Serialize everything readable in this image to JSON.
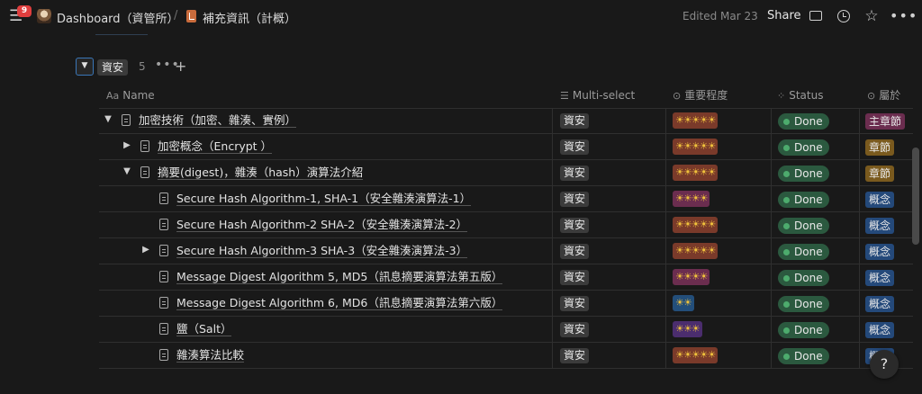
{
  "topbar": {
    "notification_count": "9",
    "workspace_title": "Dashboard（資管所）",
    "separator": "/",
    "page_title": "補充資訊（計概）",
    "edited": "Edited Mar 23",
    "share_label": "Share",
    "icons": [
      "menu-icon",
      "comment-icon",
      "clock-icon",
      "star-icon",
      "more-icon"
    ]
  },
  "group": {
    "toggle_glyph": "▼",
    "tag": "資安",
    "count": "5",
    "more": "•••",
    "add": "+"
  },
  "columns": {
    "name": "Name",
    "name_prefix": "Aa",
    "multiselect": "Multi-select",
    "multiselect_prefix": "☰",
    "importance": "重要程度",
    "importance_prefix": "⊙",
    "status": "Status",
    "status_prefix": "⁘",
    "belong": "屬於",
    "belong_prefix": "⊙"
  },
  "colors": {
    "stars5": "#7a3a2a",
    "stars4": "#6b2d4f",
    "stars3": "#4b2d6e",
    "stars2": "#234e7a",
    "belong_main": "#6b2d4f",
    "belong_chapter": "#7a5a1e",
    "belong_concept": "#24497a",
    "status_bg": "#2b593f"
  },
  "rows": [
    {
      "indent": 0,
      "chevron": "▼",
      "title": "加密技術（加密、雜湊、實例）",
      "multi": "資安",
      "importance": "☀☀☀☀☀",
      "level": 5,
      "status": "Done",
      "belong": "主章節",
      "belong_type": "main"
    },
    {
      "indent": 1,
      "chevron": "▶",
      "title": "加密概念（Encrypt ）",
      "multi": "資安",
      "importance": "☀☀☀☀☀",
      "level": 5,
      "status": "Done",
      "belong": "章節",
      "belong_type": "chapter"
    },
    {
      "indent": 1,
      "chevron": "▼",
      "title": "摘要(digest)，雜湊（hash）演算法介紹",
      "multi": "資安",
      "importance": "☀☀☀☀☀",
      "level": 5,
      "status": "Done",
      "belong": "章節",
      "belong_type": "chapter"
    },
    {
      "indent": 2,
      "chevron": "",
      "title": "Secure Hash Algorithm-1, SHA-1（安全雜湊演算法-1）",
      "multi": "資安",
      "importance": "☀☀☀☀",
      "level": 4,
      "status": "Done",
      "belong": "概念",
      "belong_type": "concept"
    },
    {
      "indent": 2,
      "chevron": "",
      "title": "Secure Hash Algorithm-2 SHA-2（安全雜湊演算法-2）",
      "multi": "資安",
      "importance": "☀☀☀☀☀",
      "level": 5,
      "status": "Done",
      "belong": "概念",
      "belong_type": "concept"
    },
    {
      "indent": 2,
      "chevron": "▶",
      "title": "Secure Hash Algorithm-3 SHA-3（安全雜湊演算法-3）",
      "multi": "資安",
      "importance": "☀☀☀☀☀",
      "level": 5,
      "status": "Done",
      "belong": "概念",
      "belong_type": "concept"
    },
    {
      "indent": 2,
      "chevron": "",
      "title": "Message Digest Algorithm 5, MD5（訊息摘要演算法第五版）",
      "multi": "資安",
      "importance": "☀☀☀☀",
      "level": 4,
      "status": "Done",
      "belong": "概念",
      "belong_type": "concept"
    },
    {
      "indent": 2,
      "chevron": "",
      "title": "Message Digest Algorithm 6, MD6（訊息摘要演算法第六版）",
      "multi": "資安",
      "importance": "☀☀",
      "level": 2,
      "status": "Done",
      "belong": "概念",
      "belong_type": "concept"
    },
    {
      "indent": 2,
      "chevron": "",
      "title": "鹽（Salt）",
      "multi": "資安",
      "importance": "☀☀☀",
      "level": 3,
      "status": "Done",
      "belong": "概念",
      "belong_type": "concept"
    },
    {
      "indent": 2,
      "chevron": "",
      "title": "雜湊算法比較",
      "multi": "資安",
      "importance": "☀☀☀☀☀",
      "level": 5,
      "status": "Done",
      "belong": "概念",
      "belong_type": "concept"
    }
  ],
  "help_label": "?"
}
